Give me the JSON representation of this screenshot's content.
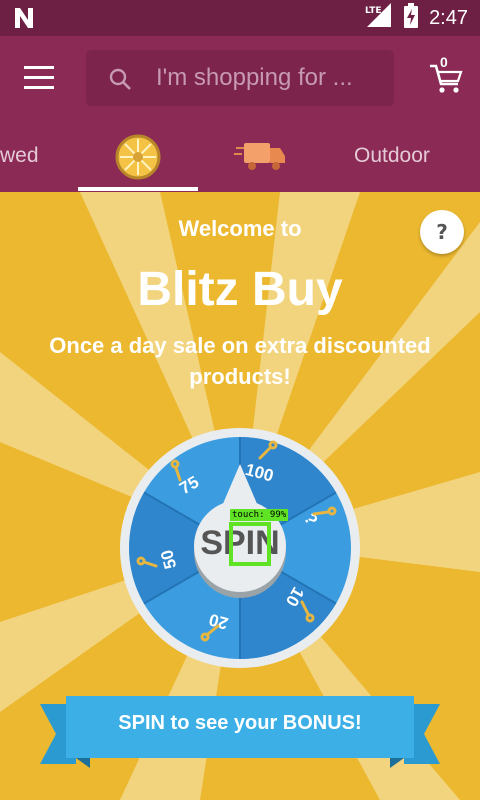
{
  "status_bar": {
    "time": "2:47",
    "network": "LTE"
  },
  "app_bar": {
    "search_placeholder": "I'm shopping for ...",
    "cart_count": "0"
  },
  "tabs": [
    {
      "label": "wed",
      "type": "text",
      "active": false
    },
    {
      "label": "",
      "type": "icon",
      "icon": "wheel-icon",
      "active": true
    },
    {
      "label": "",
      "type": "icon",
      "icon": "delivery-truck-icon",
      "active": false
    },
    {
      "label": "Outdoor",
      "type": "text",
      "active": false
    }
  ],
  "promo": {
    "welcome": "Welcome to",
    "title": "Blitz Buy",
    "subtitle": "Once a day sale on extra discounted products!",
    "help": "?",
    "spin_button": "SPIN",
    "banner": "SPIN to see your BONUS!"
  },
  "wheel": {
    "segments": [
      "100",
      "?",
      "10",
      "20",
      "50",
      "75"
    ]
  },
  "overlay": {
    "touch_label": "touch: 99%"
  },
  "colors": {
    "status_bar": "#6e1f44",
    "app_bar": "#8a2a55",
    "background_yellow": "#ebb830",
    "wheel_blue": "#3b9de0",
    "ribbon_blue": "#3cb0e6"
  }
}
